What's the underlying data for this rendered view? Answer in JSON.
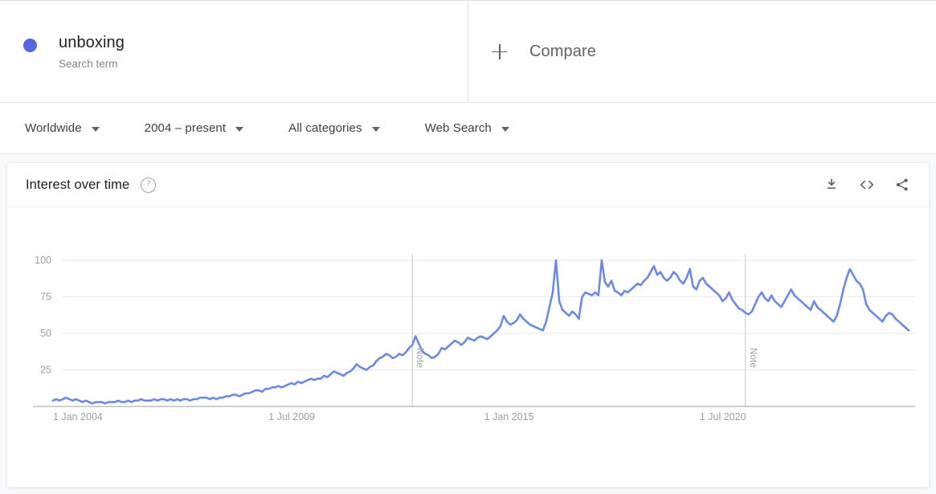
{
  "query": {
    "term": "unboxing",
    "type_label": "Search term",
    "dot_color": "#5567e0",
    "compare_label": "Compare",
    "plus_icon": "plus-icon"
  },
  "filters": [
    {
      "label": "Worldwide",
      "icon": "chevron-down-icon"
    },
    {
      "label": "2004 – present",
      "icon": "chevron-down-icon"
    },
    {
      "label": "All categories",
      "icon": "chevron-down-icon"
    },
    {
      "label": "Web Search",
      "icon": "chevron-down-icon"
    }
  ],
  "card": {
    "title": "Interest over time",
    "help_icon": "help-icon",
    "help_glyph": "?",
    "actions": [
      {
        "name": "download-icon"
      },
      {
        "name": "embed-code-icon"
      },
      {
        "name": "share-icon"
      }
    ]
  },
  "chart_data": {
    "type": "line",
    "title": "Interest over time",
    "xlabel": "",
    "ylabel": "",
    "ylim": [
      0,
      100
    ],
    "yticks": [
      25,
      50,
      75,
      100
    ],
    "grid": true,
    "legend": "none",
    "line_color": "#6b8ae4",
    "x_tick_labels": [
      "1 Jan 2004",
      "1 Jul 2009",
      "1 Jan 2015",
      "1 Jul 2020"
    ],
    "x_tick_positions": [
      0,
      66,
      132,
      198
    ],
    "annotations": [
      {
        "label": "Note",
        "x_index": 110
      },
      {
        "label": "Note",
        "x_index": 212
      }
    ],
    "series": [
      {
        "name": "unboxing",
        "values": [
          4,
          5,
          4,
          5,
          6,
          5,
          4,
          5,
          4,
          3,
          4,
          3,
          2,
          3,
          3,
          3,
          2,
          3,
          3,
          3,
          4,
          3,
          3,
          4,
          3,
          4,
          4,
          5,
          4,
          4,
          4,
          5,
          4,
          5,
          5,
          4,
          5,
          4,
          5,
          4,
          5,
          5,
          4,
          5,
          5,
          6,
          6,
          6,
          5,
          6,
          5,
          6,
          6,
          7,
          7,
          8,
          8,
          7,
          8,
          9,
          9,
          10,
          11,
          11,
          10,
          12,
          12,
          13,
          13,
          14,
          13,
          14,
          15,
          16,
          15,
          17,
          16,
          17,
          18,
          19,
          18,
          19,
          19,
          21,
          20,
          22,
          24,
          23,
          22,
          21,
          23,
          24,
          26,
          29,
          27,
          26,
          25,
          27,
          28,
          31,
          33,
          34,
          36,
          35,
          33,
          34,
          36,
          35,
          37,
          40,
          42,
          48,
          43,
          38,
          36,
          35,
          33,
          34,
          36,
          40,
          39,
          41,
          43,
          45,
          44,
          42,
          44,
          47,
          46,
          45,
          47,
          48,
          47,
          46,
          48,
          50,
          52,
          55,
          62,
          58,
          56,
          57,
          59,
          63,
          60,
          58,
          56,
          55,
          54,
          53,
          52,
          58,
          68,
          78,
          100,
          72,
          66,
          64,
          62,
          65,
          63,
          60,
          75,
          78,
          77,
          76,
          78,
          76,
          100,
          85,
          82,
          86,
          79,
          78,
          76,
          79,
          78,
          80,
          82,
          84,
          83,
          86,
          88,
          92,
          96,
          90,
          92,
          88,
          86,
          88,
          92,
          90,
          86,
          84,
          88,
          94,
          82,
          80,
          86,
          88,
          84,
          82,
          80,
          78,
          76,
          72,
          74,
          78,
          73,
          70,
          67,
          66,
          64,
          63,
          65,
          70,
          75,
          78,
          74,
          72,
          76,
          72,
          70,
          68,
          72,
          76,
          80,
          76,
          74,
          72,
          70,
          68,
          66,
          72,
          68,
          66,
          64,
          62,
          60,
          58,
          62,
          70,
          80,
          88,
          94,
          90,
          86,
          84,
          80,
          70,
          66,
          64,
          62,
          60,
          58,
          62,
          64,
          63,
          60,
          58,
          56,
          54,
          52
        ]
      }
    ]
  }
}
